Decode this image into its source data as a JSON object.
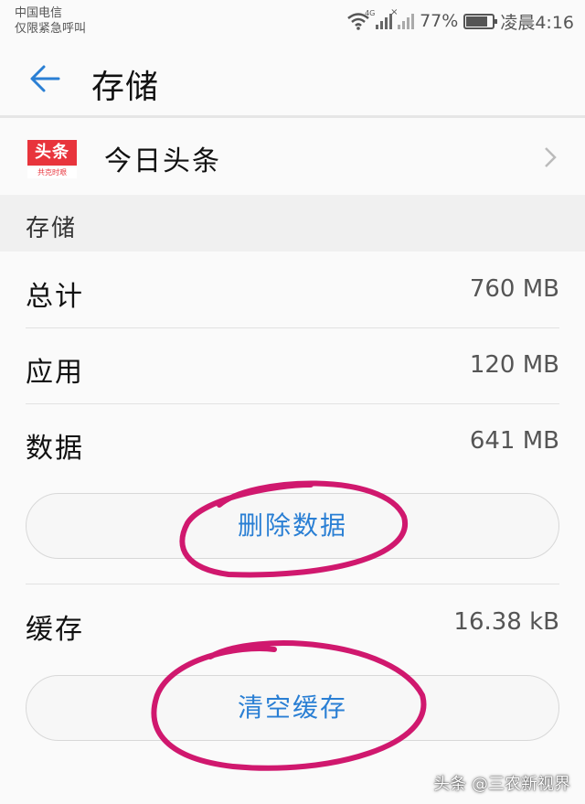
{
  "status": {
    "carrier_line1": "中国电信",
    "carrier_line2": "仅限紧急呼叫",
    "network_4g": "4G",
    "battery": "77%",
    "battery_level": 0.77,
    "time": "凌晨4:16"
  },
  "header": {
    "title": "存储"
  },
  "app": {
    "logo_top": "头条",
    "logo_bottom": "共克时艰",
    "name": "今日头条"
  },
  "section": {
    "label": "存储"
  },
  "storage": [
    {
      "label": "总计",
      "value": "760 MB"
    },
    {
      "label": "应用",
      "value": "120 MB"
    },
    {
      "label": "数据",
      "value": "641 MB"
    }
  ],
  "clear_data_label": "删除数据",
  "cache": {
    "label": "缓存",
    "value": "16.38 kB"
  },
  "clear_cache_label": "清空缓存",
  "watermark": "头条 @三农新视界",
  "colors": {
    "accent": "#2a7fd4",
    "annotation": "#d0186e",
    "logo": "#e8343c"
  }
}
